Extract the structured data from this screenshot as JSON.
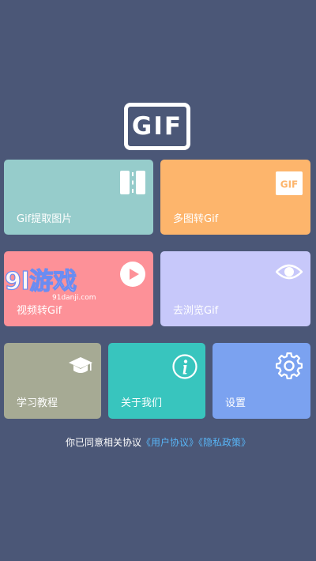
{
  "logo": {
    "text": "GIF"
  },
  "cards": {
    "gif_extract": {
      "label": "Gif提取图片",
      "color": "#96cccb",
      "icon": "film-strip-icon"
    },
    "images_to_gif": {
      "label": "多图转Gif",
      "color": "#fdb56c",
      "icon": "gif-badge-icon",
      "badge_text": "GIF"
    },
    "video_to_gif": {
      "label": "视频转Gif",
      "color": "#fd9198",
      "icon": "play-icon"
    },
    "browse_gif": {
      "label": "去浏览Gif",
      "color": "#c7c8fa",
      "icon": "eye-icon"
    },
    "tutorial": {
      "label": "学习教程",
      "color": "#a6aa94",
      "icon": "graduation-cap-icon"
    },
    "about": {
      "label": "关于我们",
      "color": "#38c5be",
      "icon": "info-icon"
    },
    "settings": {
      "label": "设置",
      "color": "#7ba2f0",
      "icon": "gear-icon"
    }
  },
  "watermark": {
    "big": "9l游戏",
    "small": "91danji.com"
  },
  "agreement": {
    "prefix": "你已同意相关协议",
    "user_agreement": "《用户协议》",
    "privacy_policy": "《隐私政策》"
  }
}
